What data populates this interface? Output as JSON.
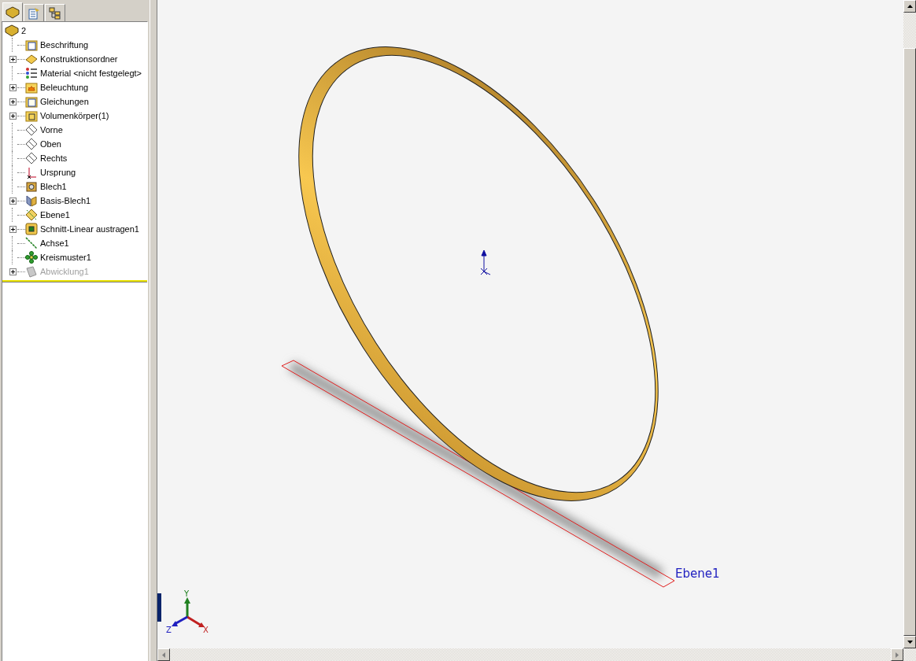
{
  "feature_tree": {
    "tabs": [
      {
        "kind": "part",
        "selected": true
      },
      {
        "kind": "properties",
        "selected": false
      },
      {
        "kind": "configurations",
        "selected": false
      }
    ],
    "root": {
      "label": "2",
      "children": [
        {
          "label": "Beschriftung",
          "kind": "annotations",
          "expandable": false,
          "disabled": false
        },
        {
          "label": "Konstruktionsordner",
          "kind": "design-folder",
          "expandable": true,
          "disabled": false
        },
        {
          "label": "Material <nicht festgelegt>",
          "kind": "material",
          "expandable": false,
          "disabled": false
        },
        {
          "label": "Beleuchtung",
          "kind": "lighting",
          "expandable": true,
          "disabled": false
        },
        {
          "label": "Gleichungen",
          "kind": "equations",
          "expandable": true,
          "disabled": false
        },
        {
          "label": "Volumenkörper(1)",
          "kind": "bodies",
          "expandable": true,
          "disabled": false
        },
        {
          "label": "Vorne",
          "kind": "plane",
          "expandable": false,
          "disabled": false
        },
        {
          "label": "Oben",
          "kind": "plane",
          "expandable": false,
          "disabled": false
        },
        {
          "label": "Rechts",
          "kind": "plane",
          "expandable": false,
          "disabled": false
        },
        {
          "label": "Ursprung",
          "kind": "origin",
          "expandable": false,
          "disabled": false
        },
        {
          "label": "Blech1",
          "kind": "sheet-metal",
          "expandable": false,
          "disabled": false
        },
        {
          "label": "Basis-Blech1",
          "kind": "base-flange",
          "expandable": true,
          "disabled": false
        },
        {
          "label": "Ebene1",
          "kind": "ref-plane",
          "expandable": false,
          "disabled": false
        },
        {
          "label": "Schnitt-Linear austragen1",
          "kind": "cut",
          "expandable": true,
          "disabled": false
        },
        {
          "label": "Achse1",
          "kind": "axis",
          "expandable": false,
          "disabled": false
        },
        {
          "label": "Kreismuster1",
          "kind": "pattern",
          "expandable": false,
          "disabled": false
        },
        {
          "label": "Abwicklung1",
          "kind": "flat-pattern",
          "expandable": true,
          "disabled": true
        }
      ]
    }
  },
  "viewport": {
    "plane_label": "Ebene1",
    "axes": {
      "x": "X",
      "y": "Y",
      "z": "Z"
    }
  }
}
